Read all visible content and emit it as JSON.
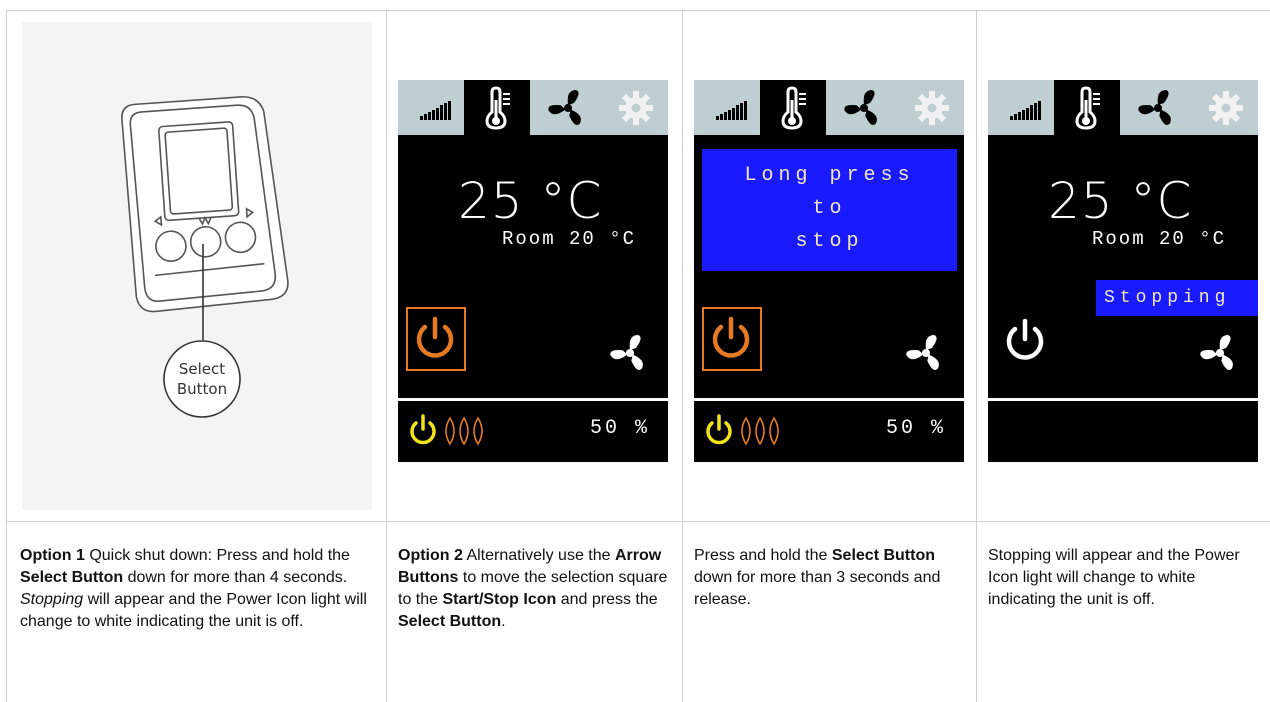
{
  "col1": {
    "device_callout": [
      "Select",
      "Button"
    ],
    "text": {
      "title": "Option 1",
      "t1": " Quick shut down: Press and hold the ",
      "b1": "Select Button",
      "t2": " down for more than 4 seconds. ",
      "i1": "Stopping",
      "t3": " will appear and the Power Icon light will change to white indicating the unit is off."
    }
  },
  "col2": {
    "screen": {
      "temperature": "25 °C",
      "room": "Room 20 °C",
      "percent": "50 %"
    },
    "text": {
      "title": "Option 2",
      "t1": " Alternatively use the ",
      "b1": "Arrow Buttons",
      "t2": " to move the selection square to the ",
      "b2": "Start/Stop Icon",
      "t3": " and press the ",
      "b3": "Select Button",
      "t4": "."
    }
  },
  "col3": {
    "screen": {
      "message": [
        "Long press",
        "to",
        "stop"
      ],
      "percent": "50 %"
    },
    "text": {
      "t1": "Press and hold the ",
      "b1": "Select Button",
      "t2": " down for more than 3 seconds and release."
    }
  },
  "col4": {
    "screen": {
      "temperature": "25 °C",
      "room": "Room 20 °C",
      "status": "Stopping"
    },
    "text": {
      "t1": "Stopping will appear and the Power Icon light will change to white indicating the unit is off."
    }
  },
  "colors": {
    "screen_bg": "#000000",
    "topbar": "#bfced3",
    "accent_orange": "#e67a23",
    "power_yellow": "#f2e41a",
    "message_blue": "#1a1aff"
  },
  "icons": [
    "signal-bars-icon",
    "thermometer-icon",
    "fan-icon",
    "gear-icon",
    "power-icon",
    "heater-coils-icon"
  ]
}
